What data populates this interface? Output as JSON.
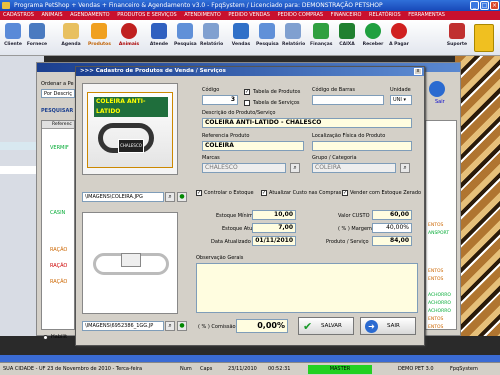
{
  "window": {
    "title": "Programa PetShop + Vendas + Financeiro & Agendamento v3.0 - FpqSystem / Licenciado para: DEMONSTRAÇÃO PETSHOP"
  },
  "menu": [
    "CADASTROS",
    "ANIMAIS",
    "AGENDAMENTO",
    "PRODUTOS E SERVIÇOS",
    "ATENDIMENTO",
    "PEDIDO VENDAS",
    "PEDIDO COMPRAS",
    "FINANCEIRO",
    "RELATÓRIOS",
    "FERRAMENTAS"
  ],
  "toolbar": [
    "Cliente",
    "Fornece",
    "Agenda",
    "Produtos",
    "Animais",
    "Atende",
    "Pesquisa",
    "Relatório",
    "Vendas",
    "Pesquisa",
    "Relatório",
    "Finanças",
    "CAIXA",
    "Receber",
    "A Pagar",
    "Suporte"
  ],
  "backform": {
    "order_label": "Ordenar a Pe",
    "order_value": "Por Descriç",
    "search_label": "PESQUISAR",
    "col_header": "Referenc",
    "sair": "Sair",
    "radio_label": "Habilit",
    "rows": [
      "VERMIF",
      "CASIN",
      "RAÇÃO",
      "RAÇÃO",
      "RAÇÃO"
    ],
    "right_rows": [
      "ENTOS",
      "ANSPORT",
      "ENTOS",
      "ENTOS",
      "ACHORRO",
      "ACHORRO",
      "ACHORRO",
      "ENTOS",
      "ENTOS",
      "ENTOS"
    ]
  },
  "modal": {
    "title": ">>> Cadastro de Produtos de Venda / Serviços",
    "codigo_label": "Código",
    "codigo_value": "3",
    "tabela_produtos": "Tabela de Produtos",
    "tabela_servicos": "Tabela de Serviços",
    "codigo_barras_label": "Código de Barras",
    "unidade_label": "Unidade",
    "unidade_value": "UNI",
    "descricao_label": "Descrição do Produto/Serviço",
    "descricao_value": "COLEIRA ANTI-LATIDO - CHALESCO",
    "referencia_label": "Referencia Produto",
    "referencia_value": "COLEIRA",
    "localizacao_label": "Localização Física do Produto",
    "marcas_label": "Marcas",
    "marcas_value": "CHALESCO",
    "grupo_label": "Grupo / Categoria",
    "grupo_value": "COLEIRA",
    "image1_path": "\\IMAGENS\\COLEIRA.JPG",
    "image1_text": "COLEIRA ANTI-LATIDO",
    "image1_brand": "CHALESCO",
    "image2_path": "\\IMAGENS\\6952386_1GG.JP",
    "controlar_estoque": "Controlar o Estoque",
    "atualizar_custo": "Atualizar Custo nas Compras",
    "vender_zerado": "Vender com Estoque Zerado",
    "estoque_minimo_label": "Estoque Mínimo",
    "estoque_minimo_value": "10,00",
    "estoque_atual_label": "Estoque Atual",
    "estoque_atual_value": "7,00",
    "data_atualizado_label": "Data Atualizado",
    "data_atualizado_value": "01/11/2010",
    "valor_custo_label": "Valor CUSTO",
    "valor_custo_value": "60,00",
    "margem_label": "( % ) Margem",
    "margem_value": "40,00%",
    "produto_servico_label": "Produto / Serviço",
    "produto_servico_value": "84,00",
    "observacao_label": "Observação Gerais",
    "comissao_label": "( % ) Comissão",
    "comissao_value": "0,00%",
    "salvar": "SALVAR",
    "sair": "SAIR"
  },
  "statusbar": {
    "city": "SUA CIDADE - UF 23 de Novembro de 2010 - Terca-feira",
    "num": "Num",
    "caps": "Caps",
    "date": "23/11/2010",
    "time": "00:52:31",
    "master": "MASTER",
    "demo": "DEMO PET 3.0",
    "brand": "FpqSystem"
  },
  "colors": {
    "menu": "#c8102e",
    "title": "#1b3f8f",
    "field": "#fffde0"
  }
}
